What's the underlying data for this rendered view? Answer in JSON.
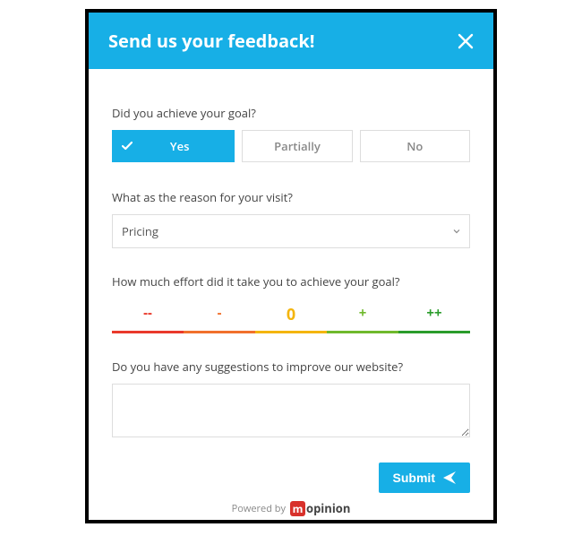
{
  "header": {
    "title": "Send us your feedback!"
  },
  "q1": {
    "label": "Did you achieve your goal?",
    "options": [
      "Yes",
      "Partially",
      "No"
    ],
    "selected_index": 0
  },
  "q2": {
    "label": "What as the reason for your visit?",
    "selected": "Pricing"
  },
  "q3": {
    "label": "How much effort did it take you to achieve your goal?",
    "scale": [
      "--",
      "-",
      "0",
      "+",
      "++"
    ]
  },
  "q4": {
    "label": "Do you have any suggestions to improve our website?",
    "value": ""
  },
  "submit": {
    "label": "Submit"
  },
  "footer": {
    "powered_by": "Powered by",
    "brand_m": "m",
    "brand_rest": "opinion"
  },
  "colors": {
    "accent": "#17afe6",
    "effort": [
      "#e9392b",
      "#f1702c",
      "#f4b50e",
      "#6fb92c",
      "#2a9c2b"
    ]
  }
}
